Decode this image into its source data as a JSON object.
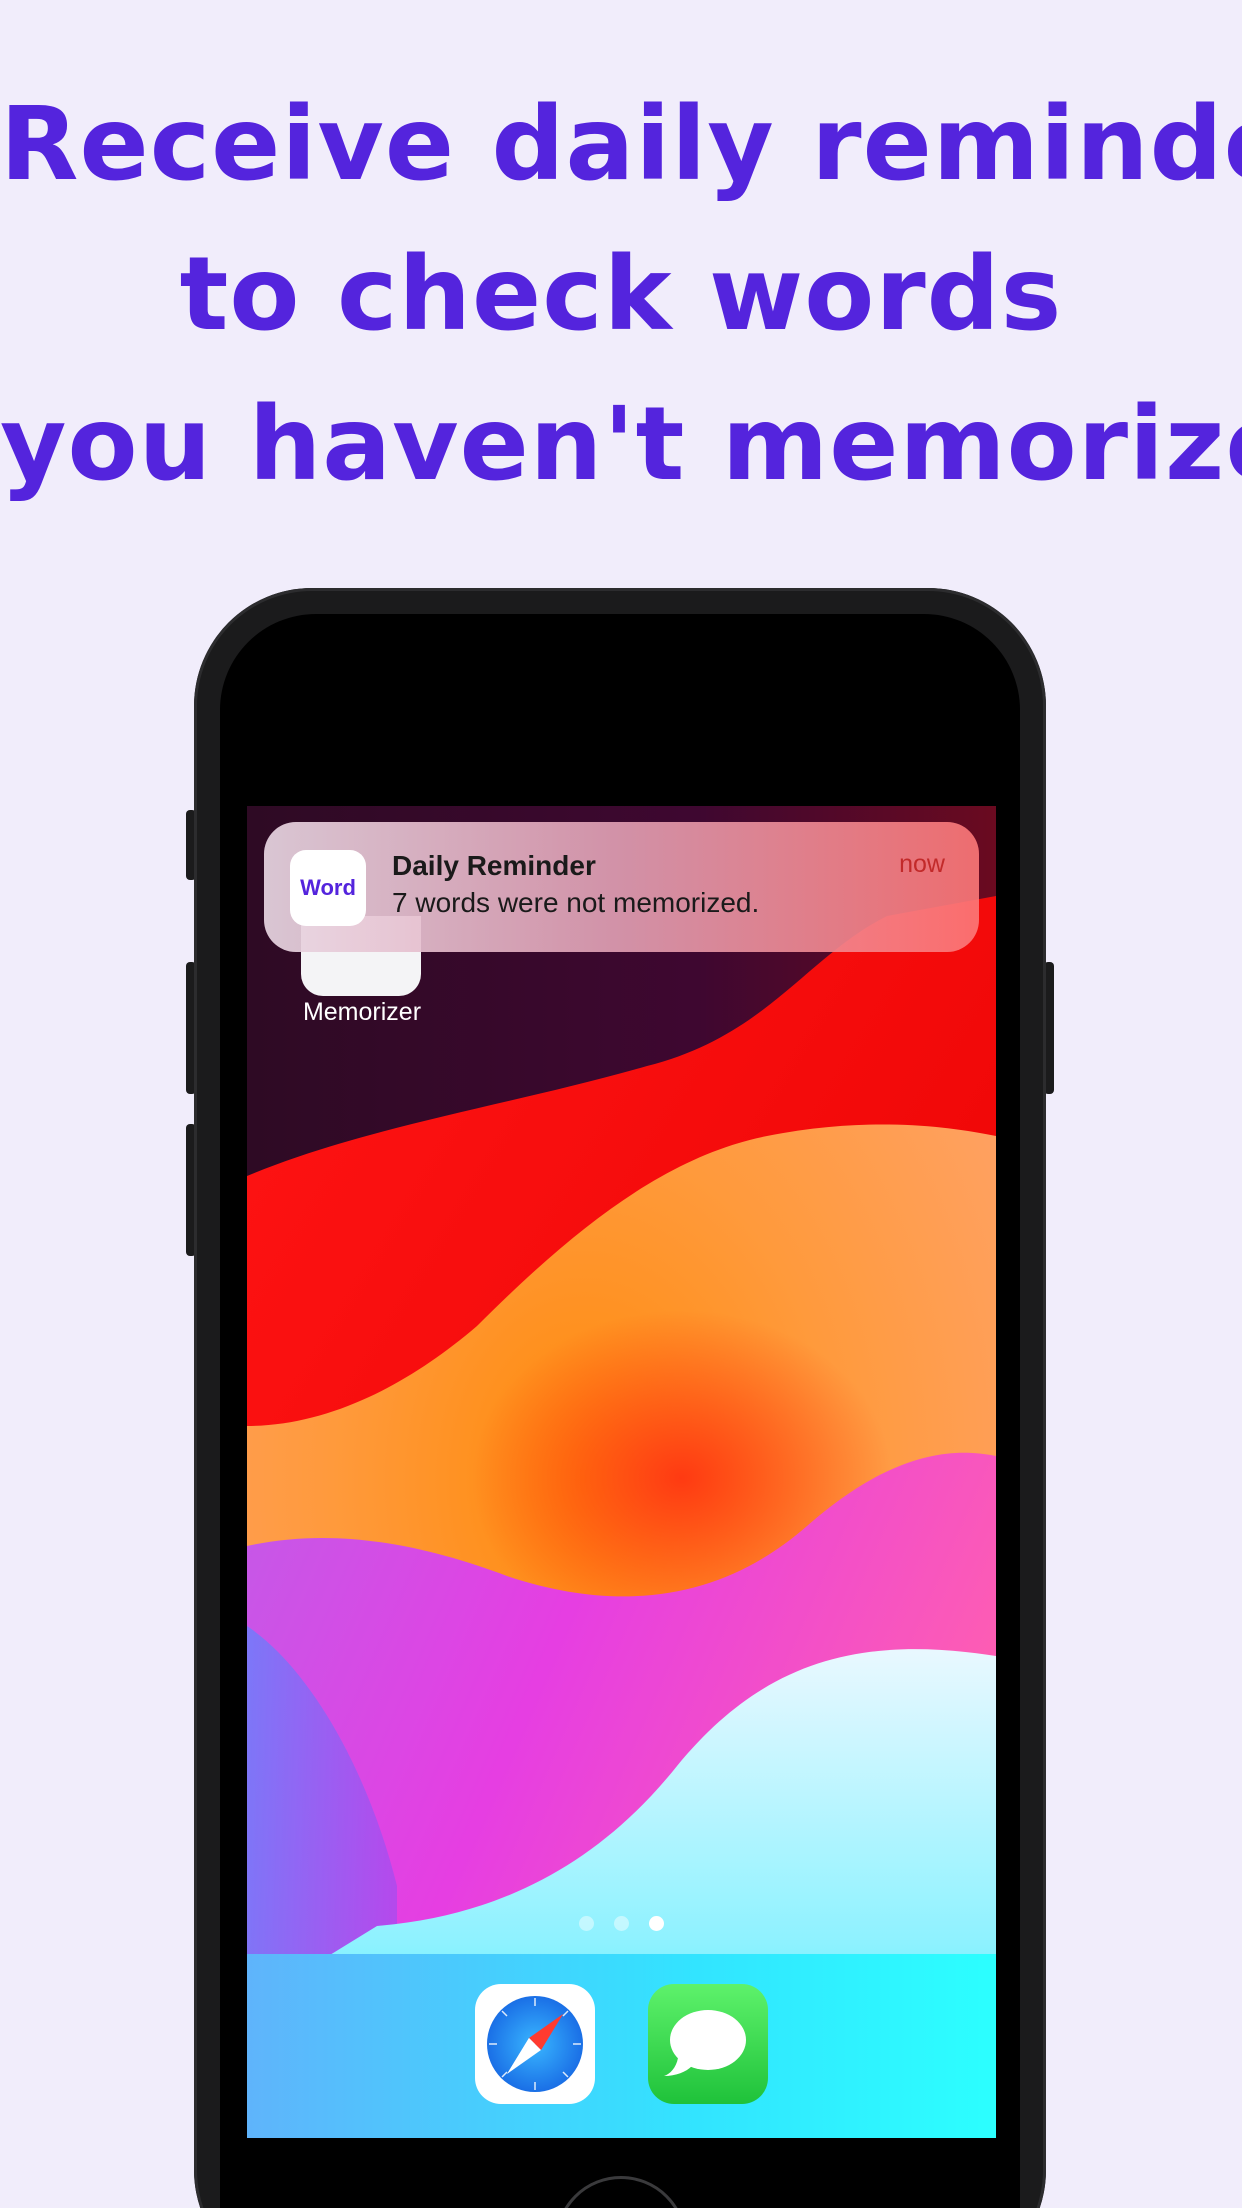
{
  "headline": {
    "line1": "Receive daily reminder",
    "line2": "to check words",
    "line3": "you haven't memorized"
  },
  "home_screen": {
    "app_label": "Memorizer"
  },
  "notification": {
    "app_icon_text": "Word",
    "title": "Daily Reminder",
    "body": "7 words were not memorized.",
    "time": "now"
  },
  "page_indicator": {
    "pages": 3,
    "current_page": 3
  },
  "dock": {
    "apps": [
      "safari-icon",
      "messages-icon"
    ]
  },
  "colors": {
    "accent": "#5424dd",
    "background": "#f1edfb"
  }
}
